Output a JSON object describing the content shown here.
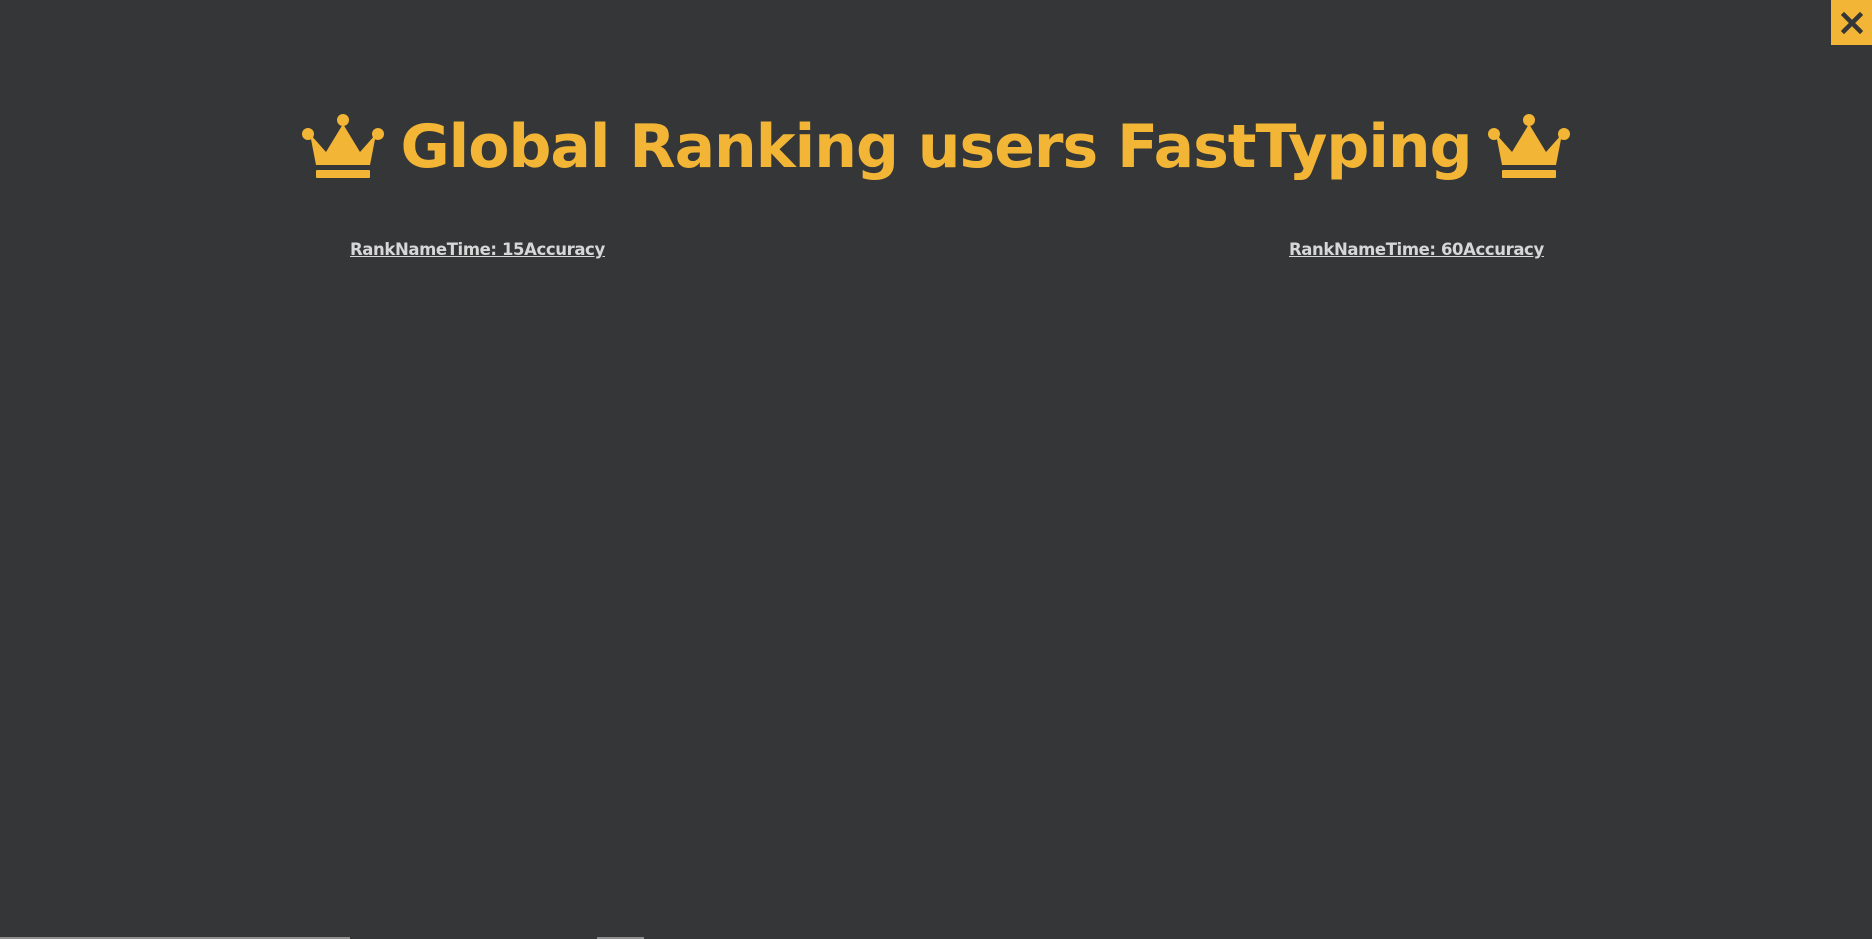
{
  "page": {
    "title": "Global Ranking users FastTyping",
    "close_icon": "close-icon",
    "crown_icon": "crown-icon"
  },
  "tables": [
    {
      "columns": [
        "Rank",
        "Name",
        "Time: 15",
        "Accuracy"
      ]
    },
    {
      "columns": [
        "Rank",
        "Name",
        "Time: 60",
        "Accuracy"
      ]
    }
  ],
  "colors": {
    "background": "#353638",
    "accent": "#f2b535",
    "header_text": "#d7d7d7"
  }
}
